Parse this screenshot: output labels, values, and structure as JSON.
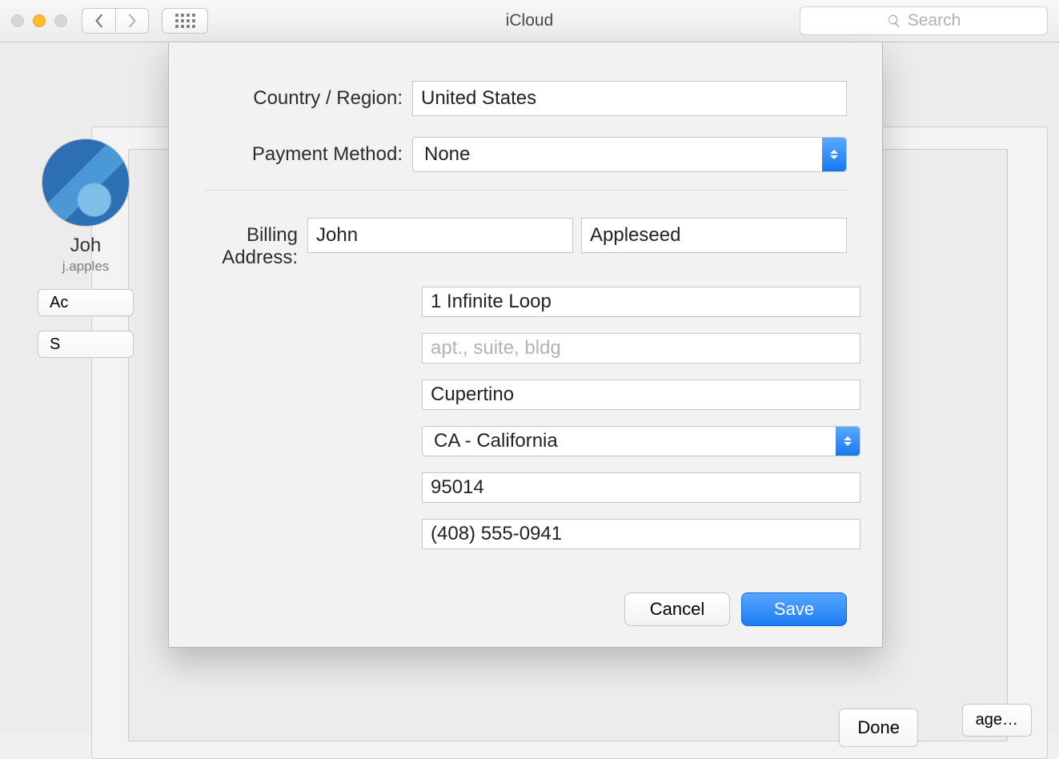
{
  "window": {
    "title": "iCloud",
    "search_placeholder": "Search"
  },
  "profile": {
    "name_partial": "Joh",
    "email_partial": "j.apples",
    "btn_account_partial": "Ac",
    "btn_signout_partial": "S"
  },
  "background_buttons": {
    "manage": "age…",
    "done": "Done"
  },
  "form": {
    "labels": {
      "country_region": "Country / Region:",
      "payment_method": "Payment Method:",
      "billing_address": "Billing Address:"
    },
    "country_region": "United States",
    "payment_method": "None",
    "first_name": "John",
    "last_name": "Appleseed",
    "street": "1 Infinite Loop",
    "apt_placeholder": "apt., suite, bldg",
    "apt_value": "",
    "city": "Cupertino",
    "state": "CA - California",
    "zip": "95014",
    "phone": "(408) 555-0941"
  },
  "buttons": {
    "cancel": "Cancel",
    "save": "Save"
  }
}
